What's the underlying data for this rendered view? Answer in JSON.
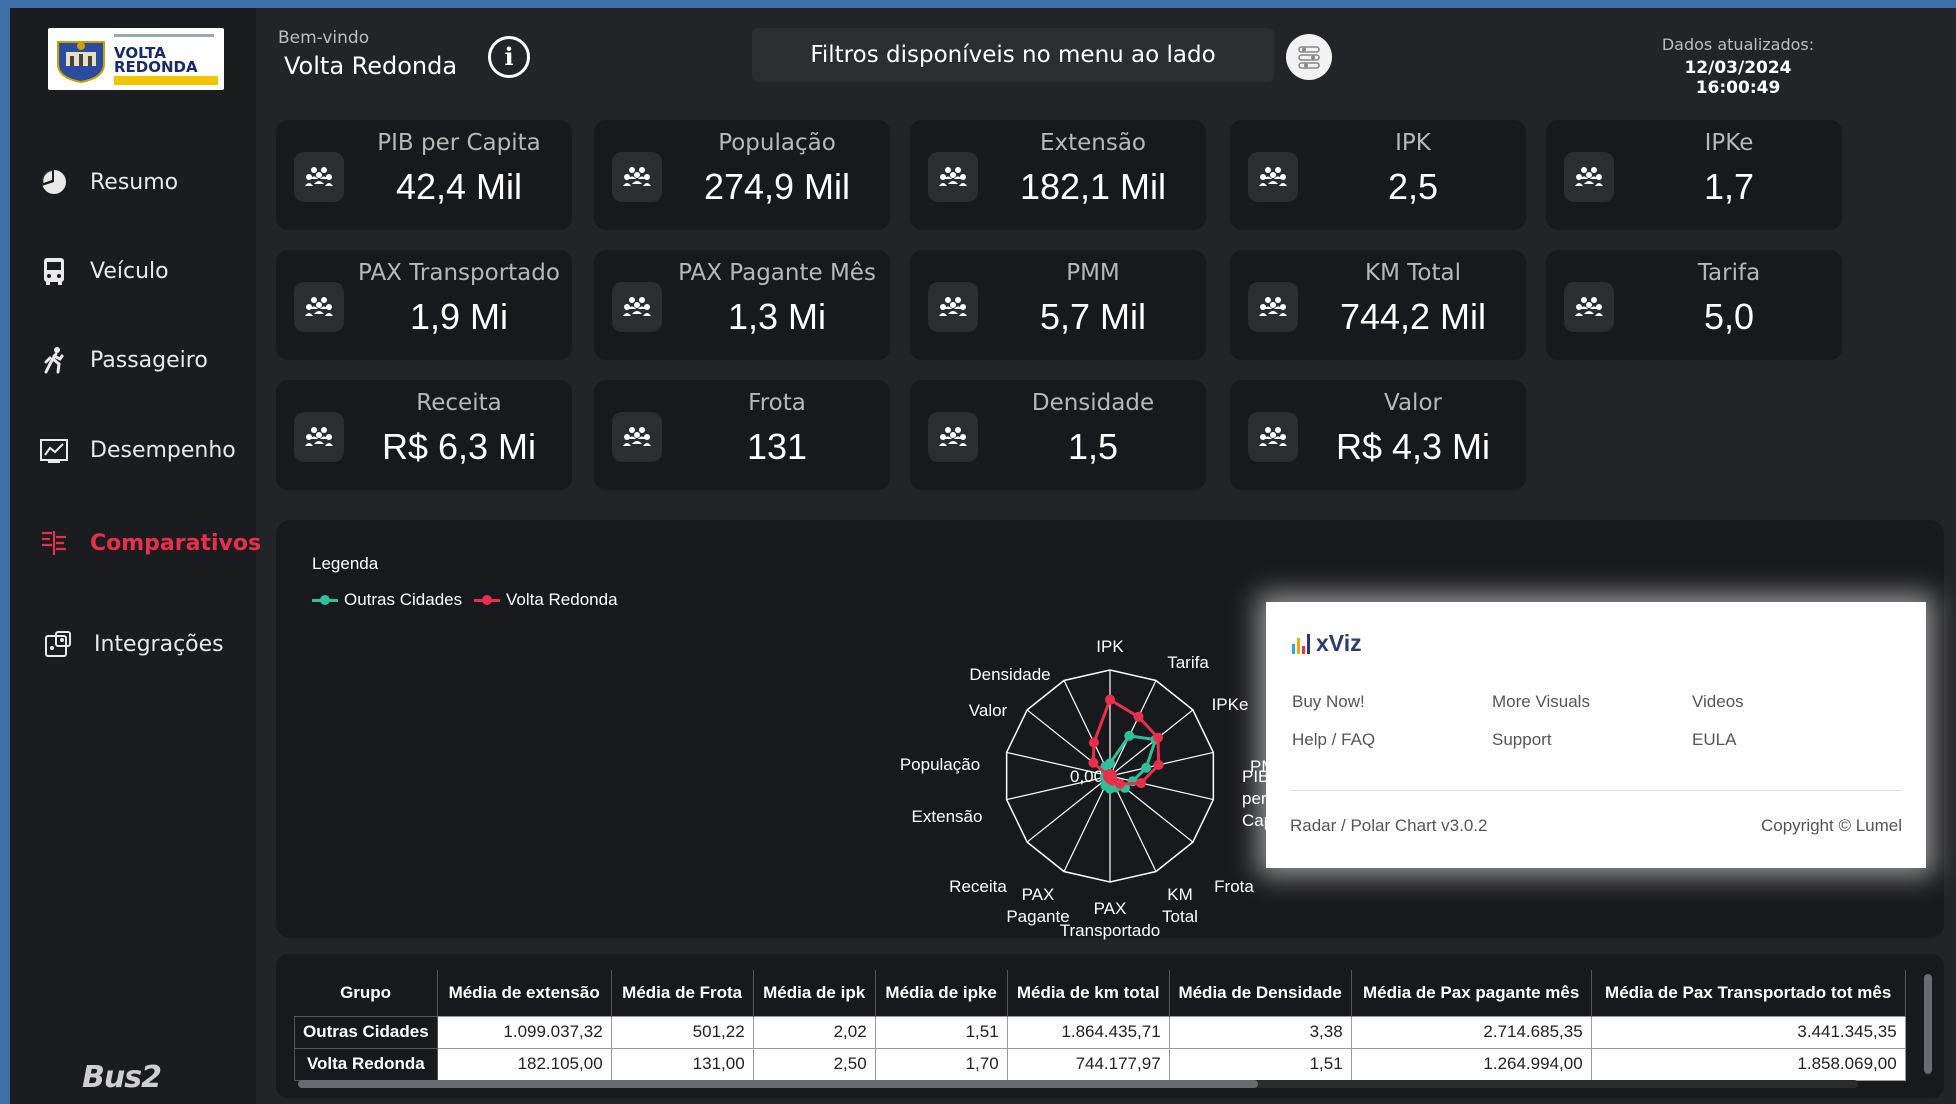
{
  "header": {
    "welcome": "Bem-vindo",
    "city": "Volta Redonda",
    "filter_banner": "Filtros disponíveis no menu ao lado",
    "updated_label": "Dados atualizados:",
    "updated_value": "12/03/2024 16:00:49"
  },
  "logo": {
    "line1": "VOLTA",
    "line2": "REDONDA"
  },
  "sidebar": {
    "items": [
      {
        "label": "Resumo",
        "icon": "pie-chart-icon",
        "active": false
      },
      {
        "label": "Veículo",
        "icon": "bus-icon",
        "active": false
      },
      {
        "label": "Passageiro",
        "icon": "walking-person-icon",
        "active": false
      },
      {
        "label": "Desempenho",
        "icon": "line-chart-icon",
        "active": false
      },
      {
        "label": "Comparativos",
        "icon": "compare-icon",
        "active": true
      },
      {
        "label": "Integrações",
        "icon": "integration-icon",
        "active": false
      }
    ],
    "footer_brand": "Bus2"
  },
  "kpis": [
    {
      "label": "PIB per Capita",
      "value": "42,4 Mil"
    },
    {
      "label": "População",
      "value": "274,9 Mil"
    },
    {
      "label": "Extensão",
      "value": "182,1 Mil"
    },
    {
      "label": "IPK",
      "value": "2,5"
    },
    {
      "label": "IPKe",
      "value": "1,7"
    },
    {
      "label": "PAX Transportado",
      "value": "1,9 Mi"
    },
    {
      "label": "PAX Pagante Mês",
      "value": "1,3 Mi"
    },
    {
      "label": "PMM",
      "value": "5,7 Mil"
    },
    {
      "label": "KM Total",
      "value": "744,2 Mil"
    },
    {
      "label": "Tarifa",
      "value": "5,0"
    },
    {
      "label": "Receita",
      "value": "R$ 6,3 Mi"
    },
    {
      "label": "Frota",
      "value": "131"
    },
    {
      "label": "Densidade",
      "value": "1,5"
    },
    {
      "label": "Valor",
      "value": "R$ 4,3 Mi"
    }
  ],
  "colors": {
    "accent": "#e8304a",
    "outras": "#2fbf9a",
    "volta": "#e8304a"
  },
  "chart_data": {
    "type": "radar",
    "legend_title": "Legenda",
    "center_label": "0,00",
    "axes": [
      "IPK",
      "Tarifa",
      "IPKe",
      "PMM",
      "PIB per Capita",
      "Frota",
      "KM Total",
      "PAX Transportado",
      "PAX Pagante",
      "Receita",
      "Extensão",
      "População",
      "Valor",
      "Densidade"
    ],
    "series": [
      {
        "name": "Outras Cidades",
        "values": [
          0.12,
          0.42,
          0.55,
          0.35,
          0.22,
          0.18,
          0.12,
          0.12,
          0.1,
          0.05,
          0.05,
          0.02,
          0.05,
          0.1
        ]
      },
      {
        "name": "Volta Redonda",
        "values": [
          0.72,
          0.62,
          0.58,
          0.47,
          0.3,
          0.12,
          0.05,
          0.03,
          0.02,
          0.02,
          0.02,
          0.02,
          0.2,
          0.35
        ]
      }
    ]
  },
  "xviz": {
    "brand": "xViz",
    "links": [
      "Buy Now!",
      "More Visuals",
      "Videos",
      "Help / FAQ",
      "Support",
      "EULA"
    ],
    "version": "Radar / Polar Chart v3.0.2",
    "copyright": "Copyright © Lumel"
  },
  "table": {
    "headers": [
      "Grupo",
      "Média de extensão",
      "Média de Frota",
      "Média de ipk",
      "Média de ipke",
      "Média de km total",
      "Média de Densidade",
      "Média de Pax pagante mês",
      "Média de Pax Transportado tot mês"
    ],
    "rows": [
      [
        "Outras Cidades",
        "1.099.037,32",
        "501,22",
        "2,02",
        "1,51",
        "1.864.435,71",
        "3,38",
        "2.714.685,35",
        "3.441.345,35"
      ],
      [
        "Volta Redonda",
        "182.105,00",
        "131,00",
        "2,50",
        "1,70",
        "744.177,97",
        "1,51",
        "1.264.994,00",
        "1.858.069,00"
      ]
    ]
  }
}
